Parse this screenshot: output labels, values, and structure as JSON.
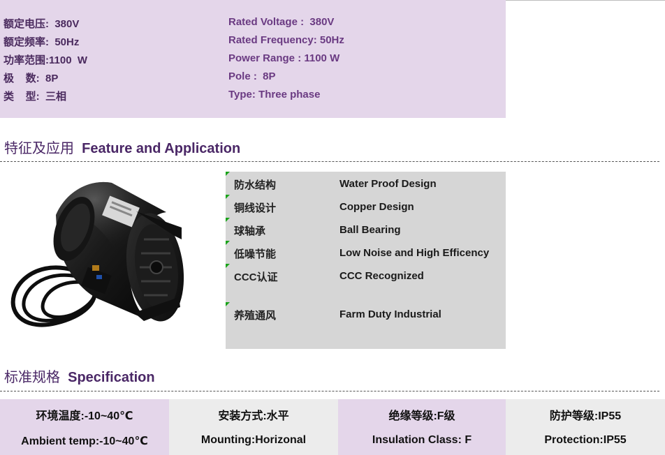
{
  "ratings": {
    "zh": [
      "额定电压:  380V",
      "额定频率:  50Hz",
      "功率范围:1100  W",
      "极    数:  8P",
      "类    型:  三相"
    ],
    "en": [
      "Rated Voltage :  380V",
      "Rated Frequency: 50Hz",
      "Power Range : 1100 W",
      "Pole :  8P",
      "Type: Three phase"
    ]
  },
  "feature_section": {
    "title_zh": "特征及应用",
    "title_en": "Feature and Application"
  },
  "features": [
    {
      "zh": "防水结构",
      "en": "Water Proof Design"
    },
    {
      "zh": "铜线设计",
      "en": "Copper Design"
    },
    {
      "zh": "球轴承",
      "en": "Ball Bearing"
    },
    {
      "zh": "低噪节能",
      "en": "Low Noise and High Efficency"
    },
    {
      "zh": "CCC认证",
      "en": "CCC Recognized"
    },
    {
      "zh": "养殖通风",
      "en": "Farm Duty Industrial"
    }
  ],
  "spec_section": {
    "title_zh": "标准规格",
    "title_en": "Specification"
  },
  "specs": [
    {
      "zh": "环境温度:-10~40℃",
      "en": "Ambient temp:-10~40℃"
    },
    {
      "zh": "安装方式:水平",
      "en": "Mounting:Horizonal"
    },
    {
      "zh": "绝缘等级:F级",
      "en": "Insulation Class: F"
    },
    {
      "zh": "防护等级:IP55",
      "en": "Protection:IP55"
    }
  ],
  "colors": {
    "lavender_panel": "#e4d6ea",
    "grey_panel": "#d6d6d6",
    "title_purple": "#4a2766",
    "marker_green": "#1aa31a"
  },
  "icons": [
    "motor-product-photo"
  ]
}
